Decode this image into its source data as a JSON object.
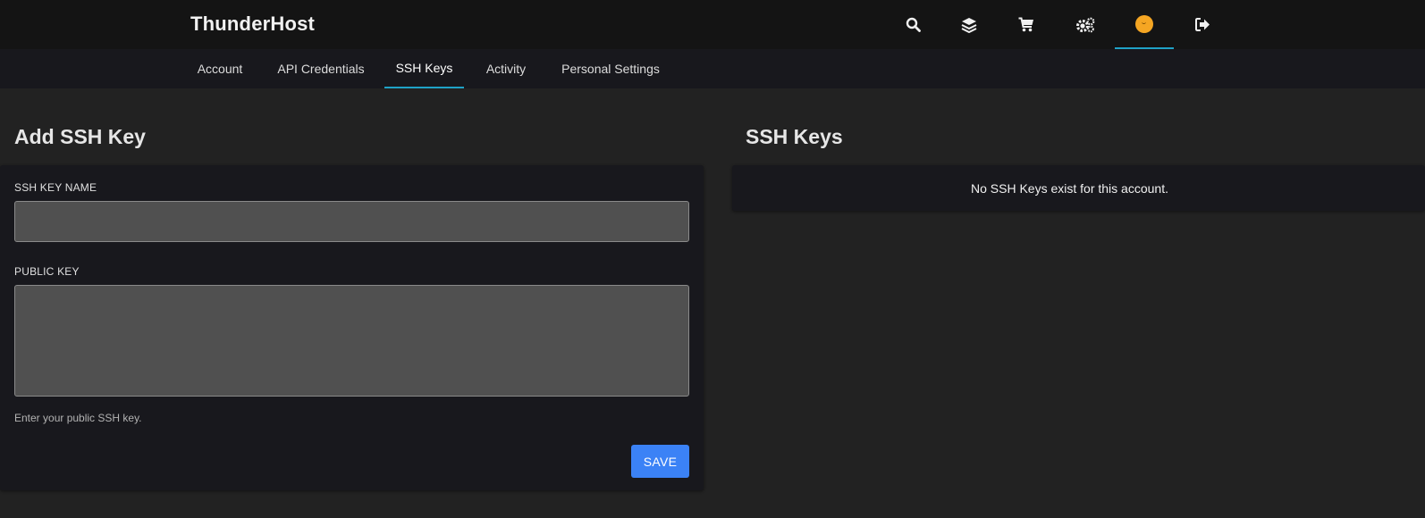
{
  "app": {
    "brand": "ThunderHost"
  },
  "topnav": {
    "icons": [
      {
        "name": "search-icon"
      },
      {
        "name": "layers-icon"
      },
      {
        "name": "cart-icon"
      },
      {
        "name": "gears-icon"
      },
      {
        "name": "avatar-icon",
        "active": true
      },
      {
        "name": "sign-out-icon"
      }
    ]
  },
  "subnav": {
    "tabs": [
      {
        "label": "Account"
      },
      {
        "label": "API Credentials"
      },
      {
        "label": "SSH Keys",
        "active": true
      },
      {
        "label": "Activity"
      },
      {
        "label": "Personal Settings"
      }
    ]
  },
  "add_key": {
    "title": "Add SSH Key",
    "name_label": "SSH KEY NAME",
    "name_value": "",
    "public_key_label": "PUBLIC KEY",
    "public_key_value": "",
    "hint": "Enter your public SSH key.",
    "save_label": "SAVE"
  },
  "keys_list": {
    "title": "SSH Keys",
    "empty_message": "No SSH Keys exist for this account."
  },
  "colors": {
    "accent": "#1fa2c7",
    "button": "#3b82f6",
    "avatar": "#f5a623"
  }
}
